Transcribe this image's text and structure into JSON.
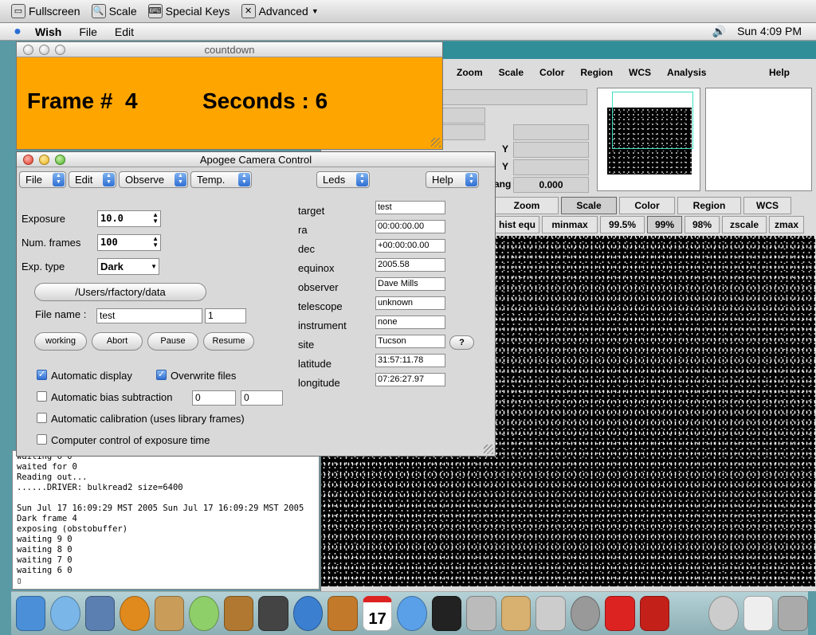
{
  "vnc_toolbar": {
    "fullscreen": "Fullscreen",
    "scale": "Scale",
    "special_keys": "Special Keys",
    "advanced": "Advanced"
  },
  "menubar": {
    "app": "Wish",
    "file": "File",
    "edit": "Edit",
    "clock": "Sun 4:09 PM"
  },
  "ds9": {
    "menu": [
      "Zoom",
      "Scale",
      "Color",
      "Region",
      "WCS",
      "Analysis"
    ],
    "help": "Help",
    "field_labels": {
      "y1": "Y",
      "y2": "Y",
      "ang": "ang"
    },
    "angle_value": "0.000",
    "buttons_row1": [
      "Zoom",
      "Scale",
      "Color",
      "Region",
      "WCS"
    ],
    "buttons_row2": [
      "hist equ",
      "minmax",
      "99.5%",
      "99%",
      "98%",
      "zscale",
      "zmax"
    ]
  },
  "countdown": {
    "title": "countdown",
    "frame_label": "Frame #",
    "frame_value": "4",
    "seconds_label": "Seconds :",
    "seconds_value": "6"
  },
  "apogee": {
    "title": "Apogee Camera Control",
    "menus": {
      "file": "File",
      "edit": "Edit",
      "observe": "Observe",
      "temp": "Temp.",
      "leds": "Leds",
      "help": "Help"
    },
    "exposure_label": "Exposure",
    "exposure_value": "10.0",
    "num_frames_label": "Num. frames",
    "num_frames_value": "100",
    "exp_type_label": "Exp. type",
    "exp_type_value": "Dark",
    "data_dir": "/Users/rfactory/data",
    "file_name_label": "File name :",
    "file_name_value": "test",
    "file_index": "1",
    "buttons": {
      "working": "working",
      "abort": "Abort",
      "pause": "Pause",
      "resume": "Resume"
    },
    "checks": {
      "auto_display": "Automatic display",
      "overwrite": "Overwrite files",
      "bias": "Automatic bias subtraction",
      "calibration": "Automatic calibration (uses library frames)",
      "computer_control": "Computer control of exposure time"
    },
    "bias_values": [
      "0",
      "0"
    ],
    "fields": [
      {
        "label": "target",
        "value": "test"
      },
      {
        "label": "ra",
        "value": "00:00:00.00"
      },
      {
        "label": "dec",
        "value": "+00:00:00.00"
      },
      {
        "label": "equinox",
        "value": "2005.58"
      },
      {
        "label": "observer",
        "value": "Dave Mills"
      },
      {
        "label": "telescope",
        "value": "unknown"
      },
      {
        "label": "instrument",
        "value": "none"
      },
      {
        "label": "site",
        "value": "Tucson"
      },
      {
        "label": "latitude",
        "value": "31:57:11.78"
      },
      {
        "label": "longitude",
        "value": "07:26:27.97"
      }
    ],
    "site_help": "?"
  },
  "terminal": {
    "text": "waiting 6 0\nwaited for 0\nReading out...\n......DRIVER: bulkread2 size=6400\n\nSun Jul 17 16:09:29 MST 2005 Sun Jul 17 16:09:29 MST 2005\nDark frame 4\nexposing (obstobuffer)\nwaiting 9 0\nwaiting 8 0\nwaiting 7 0\nwaiting 6 0\n▯"
  },
  "dock": {
    "calendar_day": "17"
  }
}
